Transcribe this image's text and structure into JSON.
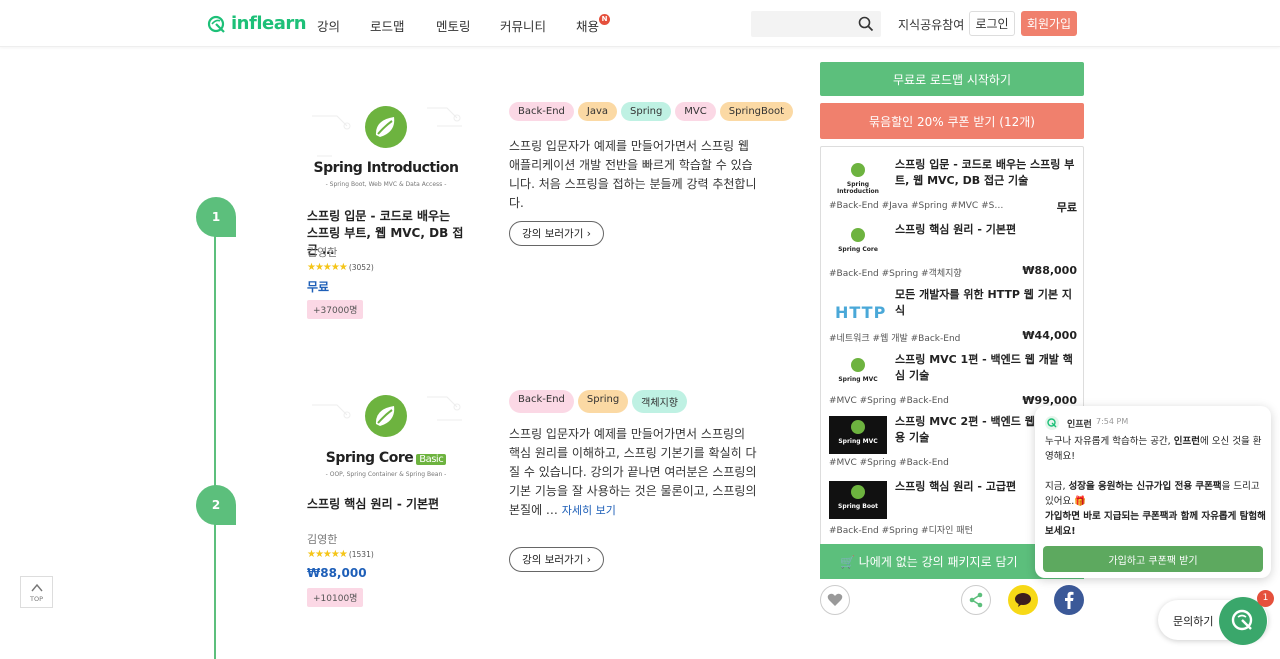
{
  "header": {
    "logo_text": "inflearn",
    "nav": [
      {
        "label": "강의"
      },
      {
        "label": "로드맵"
      },
      {
        "label": "멘토링"
      },
      {
        "label": "커뮤니티"
      },
      {
        "label": "채용"
      }
    ],
    "nav_badge": "N",
    "search_placeholder": "",
    "share_link": "지식공유참여",
    "login": "로그인",
    "signup": "회원가입"
  },
  "timeline": {
    "steps": [
      "1",
      "2"
    ]
  },
  "courses": [
    {
      "thumb_title": "Spring Introduction",
      "thumb_subtitle": "- Spring Boot, Web MVC & Data Access -",
      "title": "스프링 입문 - 코드로 배우는 스프링 부트, 웹 MVC, DB 접근 …",
      "author": "김영한",
      "rating_count": "(3052)",
      "price": "무료",
      "students": "+37000명",
      "tags": [
        "Back-End",
        "Java",
        "Spring",
        "MVC",
        "SpringBoot"
      ],
      "description": "스프링 입문자가 예제를 만들어가면서 스프링 웹 애플리케이션 개발 전반을 빠르게 학습할 수 있습니다. 처음 스프링을 접하는 분들께 강력 추천합니다.",
      "view_button": "강의 보러가기"
    },
    {
      "thumb_title": "Spring Core",
      "thumb_badge": "Basic",
      "thumb_subtitle": "- OOP, Spring Container & Spring Bean -",
      "title": "스프링 핵심 원리 - 기본편",
      "author": "김영한",
      "rating_count": "(1531)",
      "price": "₩88,000",
      "students": "+10100명",
      "tags": [
        "Back-End",
        "Spring",
        "객체지향"
      ],
      "description": "스프링 입문자가 예제를 만들어가면서 스프링의 핵심 원리를 이해하고, 스프링 기본기를 확실히 다질 수 있습니다. 강의가 끝나면 여러분은 스프링의 기본 기능을 잘 사용하는 것은 물론이고, 스프링의 본질에 …",
      "more_link": "자세히 보기",
      "view_button": "강의 보러가기"
    }
  ],
  "tag_colors": {
    "Back-End": "#fbd8e5",
    "Java": "#fbd9a4",
    "Spring": "#bff1e3",
    "MVC": "#fbd8e5",
    "SpringBoot": "#fbd9a4",
    "객체지향": "#bff1e3"
  },
  "sidebar": {
    "start_button": "무료로 로드맵 시작하기",
    "coupon_button": "묶음할인 20% 쿠폰 받기 (12개)",
    "packages": [
      {
        "thumb": "Spring Introduction",
        "title": "스프링 입문 - 코드로 배우는 스프링 부트, 웹 MVC, DB 접근 기술",
        "tags": "#Back-End #Java #Spring #MVC #S…",
        "price": "무료",
        "dark": false
      },
      {
        "thumb": "Spring Core",
        "title": "스프링 핵심 원리 - 기본편",
        "tags": "#Back-End #Spring #객체지향",
        "price": "₩88,000",
        "dark": false
      },
      {
        "thumb": "HTTP",
        "title": "모든 개발자를 위한 HTTP 웹 기본 지식",
        "tags": "#네트워크 #웹 개발 #Back-End",
        "price": "₩44,000",
        "dark": false
      },
      {
        "thumb": "Spring MVC",
        "title": "스프링 MVC 1편 - 백엔드 웹 개발 핵심 기술",
        "tags": "#MVC #Spring #Back-End",
        "price": "₩99,000",
        "dark": false
      },
      {
        "thumb": "Spring MVC",
        "title": "스프링 MVC 2편 - 백엔드 웹 개발 활용 기술",
        "tags": "#MVC #Spring #Back-End",
        "price": "₩",
        "dark": true
      },
      {
        "thumb": "Spring Boot",
        "title": "스프링 핵심 원리 - 고급편",
        "tags": "#Back-End #Spring #디자인 패턴",
        "price": "₩",
        "dark": true
      }
    ],
    "cart_button": "🛒 나에게 없는 강의 패키지로 담기"
  },
  "popup": {
    "sender": "인프런",
    "time": "7:54 PM",
    "line1": "누구나 자유롭게 학습하는 공간, ",
    "line1_bold": "인프런",
    "line1_end": "에 오신 것을 환영해요!",
    "line2": "지금, ",
    "line2_bold": "성장을 응원하는 신규가입 전용 쿠폰팩",
    "line2_end": "을 드리고 있어요.🎁",
    "line3": "가입하면 바로 지급되는 쿠폰팩과 함께 자유롭게 탐험해보세요!",
    "button": "가입하고 쿠폰팩 받기"
  },
  "floating": {
    "top_label": "TOP",
    "chat_label": "문의하기",
    "chat_badge": "1"
  },
  "colors": {
    "brand_green": "#1dc078",
    "timeline_green": "#5cbf7c",
    "coral": "#f0806d",
    "price_blue": "#1e5fb8"
  }
}
